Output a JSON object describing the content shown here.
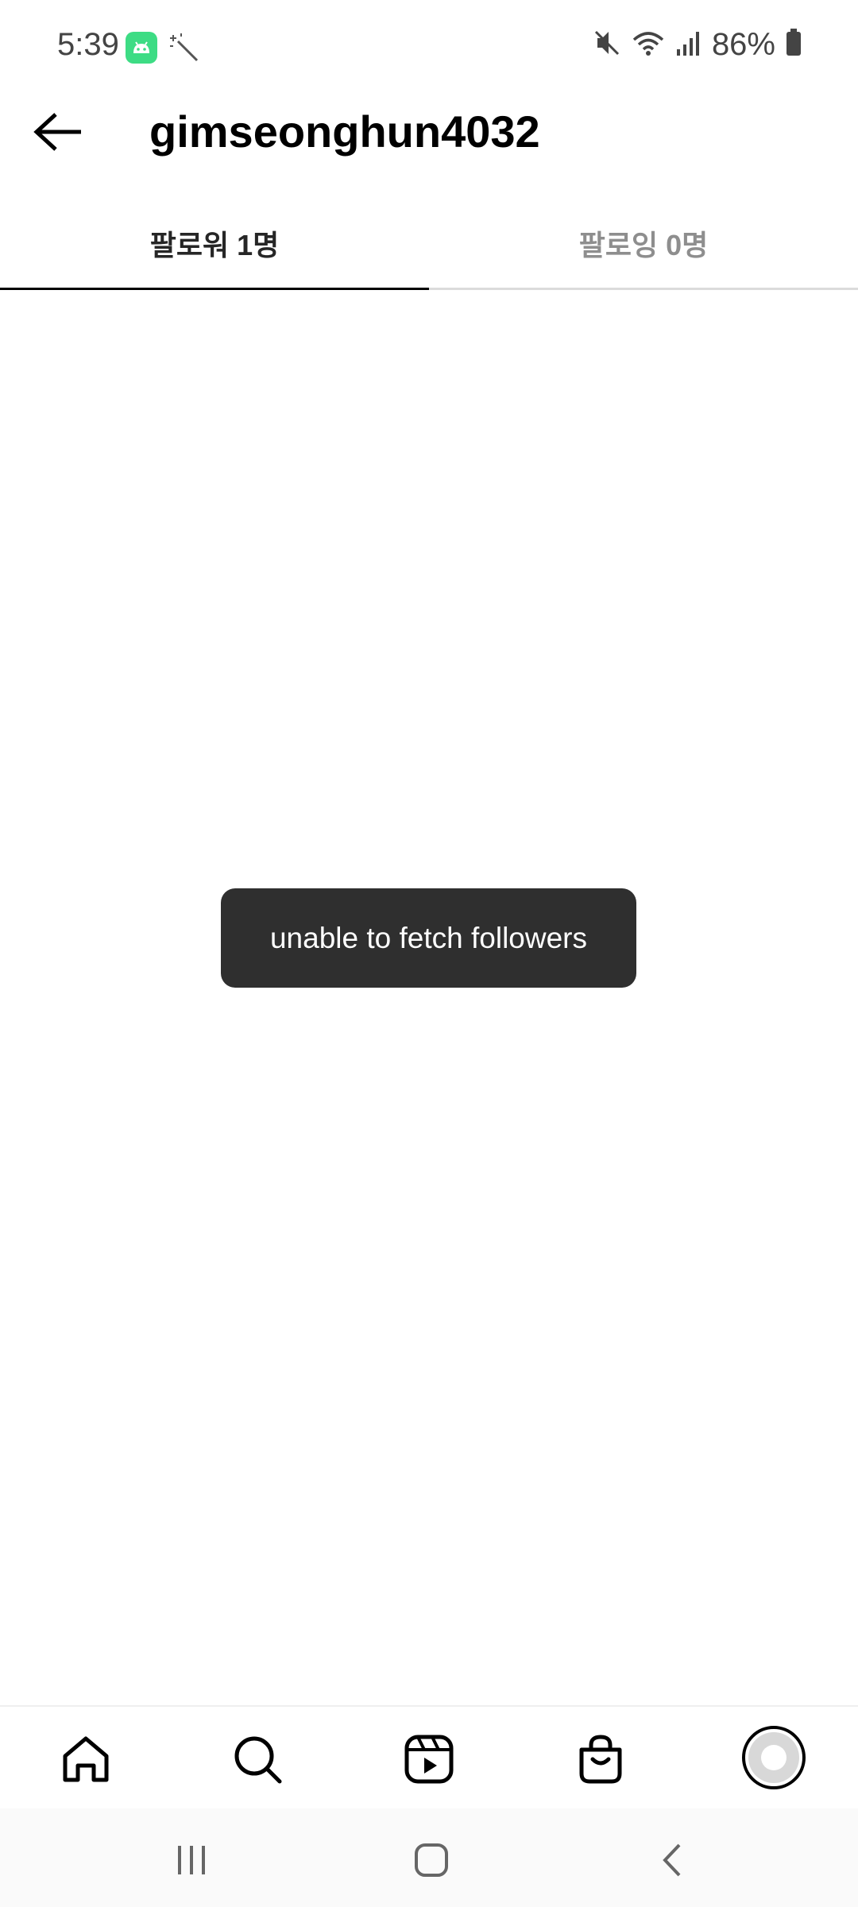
{
  "status_bar": {
    "time": "5:39",
    "battery": "86%"
  },
  "header": {
    "title": "gimseonghun4032"
  },
  "tabs": [
    {
      "label": "팔로워 1명",
      "active": true
    },
    {
      "label": "팔로잉 0명",
      "active": false
    }
  ],
  "toast": {
    "message": "unable to fetch followers"
  },
  "bottom_nav": {
    "items": [
      "home-icon",
      "search-icon",
      "reels-icon",
      "shop-icon",
      "profile-avatar"
    ]
  },
  "colors": {
    "toast_bg": "#2f2f2f",
    "active_tab": "#262626",
    "inactive_tab": "#8e8e8e"
  }
}
